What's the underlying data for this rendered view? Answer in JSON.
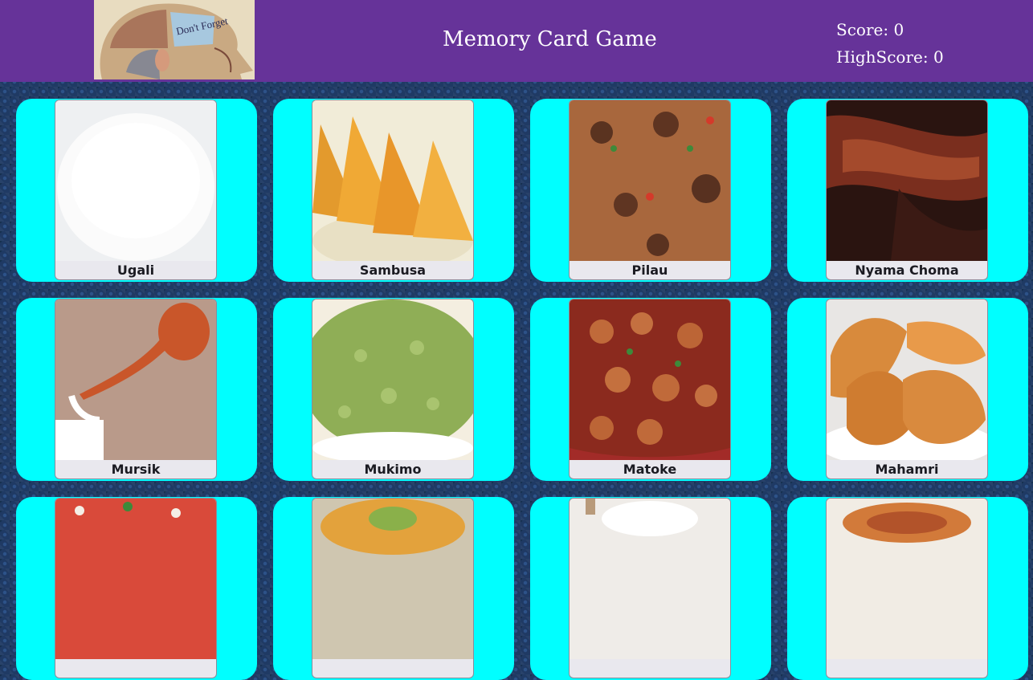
{
  "header": {
    "title": "Memory Card Game",
    "score_label": "Score:",
    "score_value": "0",
    "highscore_label": "HighScore:",
    "highscore_value": "0",
    "logo_note": "Don't Forget"
  },
  "colors": {
    "header_bg": "#663399",
    "card_bg": "#00ffff",
    "page_bg": "#1f3a64"
  },
  "cards": [
    {
      "name": "Ugali"
    },
    {
      "name": "Sambusa"
    },
    {
      "name": "Pilau"
    },
    {
      "name": "Nyama Choma"
    },
    {
      "name": "Mursik"
    },
    {
      "name": "Mukimo"
    },
    {
      "name": "Matoke"
    },
    {
      "name": "Mahamri"
    },
    {
      "name": ""
    },
    {
      "name": ""
    },
    {
      "name": ""
    },
    {
      "name": ""
    }
  ]
}
